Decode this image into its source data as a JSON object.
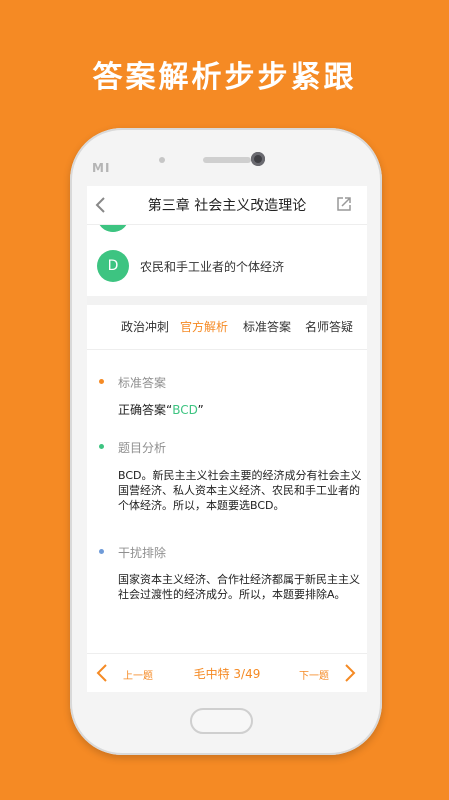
{
  "promo": {
    "title": "答案解析步步紧跟"
  },
  "phone": {
    "brand": "MI"
  },
  "navbar": {
    "title": "第三章 社会主义改造理论"
  },
  "option": {
    "letter": "D",
    "text": "农民和手工业者的个体经济"
  },
  "tabs": [
    {
      "label": "政治冲刺",
      "active": false
    },
    {
      "label": "官方解析",
      "active": true
    },
    {
      "label": "标准答案",
      "active": false
    },
    {
      "label": "名师答疑",
      "active": false
    }
  ],
  "sections": {
    "standard": {
      "title": "标准答案",
      "prefix": "正确答案“",
      "answer": "BCD",
      "suffix": "”",
      "dot_color": "#F58A24"
    },
    "analysis": {
      "title": "题目分析",
      "body": "BCD。新民主主义社会主要的经济成分有社会主义国营经济、私人资本主义经济、农民和手工业者的个体经济。所以，本题要选BCD。",
      "dot_color": "#3DC481"
    },
    "elimination": {
      "title": "干扰排除",
      "body": "国家资本主义经济、合作社经济都属于新民主主义社会过渡性的经济成分。所以，本题要排除A。",
      "dot_color": "#6F9BD8"
    }
  },
  "footer": {
    "prev": "上一题",
    "center": "毛中特 3/49",
    "next": "下一题"
  },
  "colors": {
    "accent": "#F58A24",
    "green": "#3DC481"
  }
}
